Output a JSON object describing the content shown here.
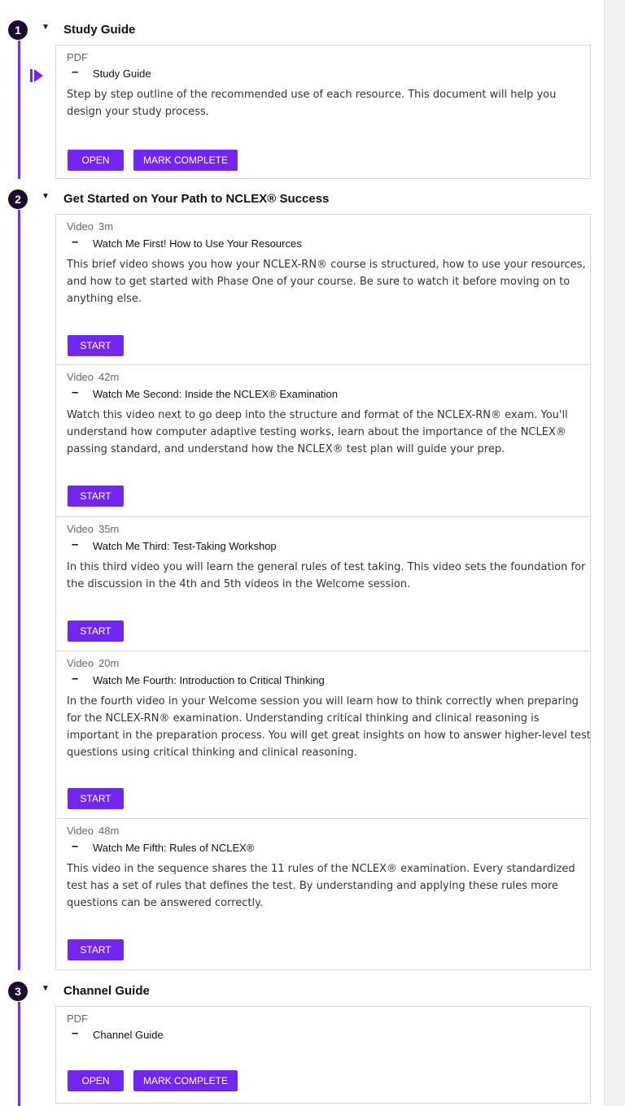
{
  "accent_color": "#7326f2",
  "sections": [
    {
      "number": "1",
      "title": "Study Guide",
      "items": [
        {
          "type": "PDF",
          "title": "Study Guide",
          "description": "Step by step outline of the recommended use of each resource. This document will help you design your study process.",
          "buttons": [
            "OPEN",
            "MARK COMPLETE"
          ]
        }
      ]
    },
    {
      "number": "2",
      "title": "Get Started on Your Path to NCLEX® Success",
      "items": [
        {
          "type": "Video",
          "duration": "3m",
          "title": "Watch Me First! How to Use Your Resources",
          "description": "This brief video shows you how your NCLEX-RN® course is structured, how to use your resources, and how to get started with Phase One of your course. Be sure to watch it before moving on to anything else.",
          "buttons": [
            "START"
          ]
        },
        {
          "type": "Video",
          "duration": "42m",
          "title": "Watch Me Second: Inside the NCLEX® Examination",
          "description": "Watch this video next to go deep into the structure and format of the NCLEX-RN® exam. You'll understand how computer adaptive testing works, learn about the importance of the NCLEX® passing standard, and understand how the NCLEX® test plan will guide your prep.",
          "buttons": [
            "START"
          ]
        },
        {
          "type": "Video",
          "duration": "35m",
          "title": "Watch Me Third: Test-Taking Workshop",
          "description": "In this third video you will learn the general rules of test taking. This video sets the foundation for the discussion in the 4th and 5th videos in the Welcome session.",
          "buttons": [
            "START"
          ]
        },
        {
          "type": "Video",
          "duration": "20m",
          "title": "Watch Me Fourth: Introduction to Critical Thinking",
          "description": "In the fourth video in your Welcome session you will learn how to think correctly when preparing for the NCLEX-RN® examination. Understanding critical thinking and clinical reasoning is important in the preparation process. You will get great insights on how to answer higher-level test questions using critical thinking and clinical reasoning.",
          "buttons": [
            "START"
          ]
        },
        {
          "type": "Video",
          "duration": "48m",
          "title": "Watch Me Fifth: Rules of NCLEX®",
          "description": "This video in the sequence shares the 11 rules of the NCLEX® examination. Every standardized test has a set of rules that defines the test. By understanding and applying these rules more questions can be answered correctly.",
          "buttons": [
            "START"
          ]
        }
      ]
    },
    {
      "number": "3",
      "title": "Channel Guide",
      "items": [
        {
          "type": "PDF",
          "title": "Channel Guide",
          "buttons": [
            "OPEN",
            "MARK COMPLETE"
          ]
        }
      ]
    }
  ]
}
